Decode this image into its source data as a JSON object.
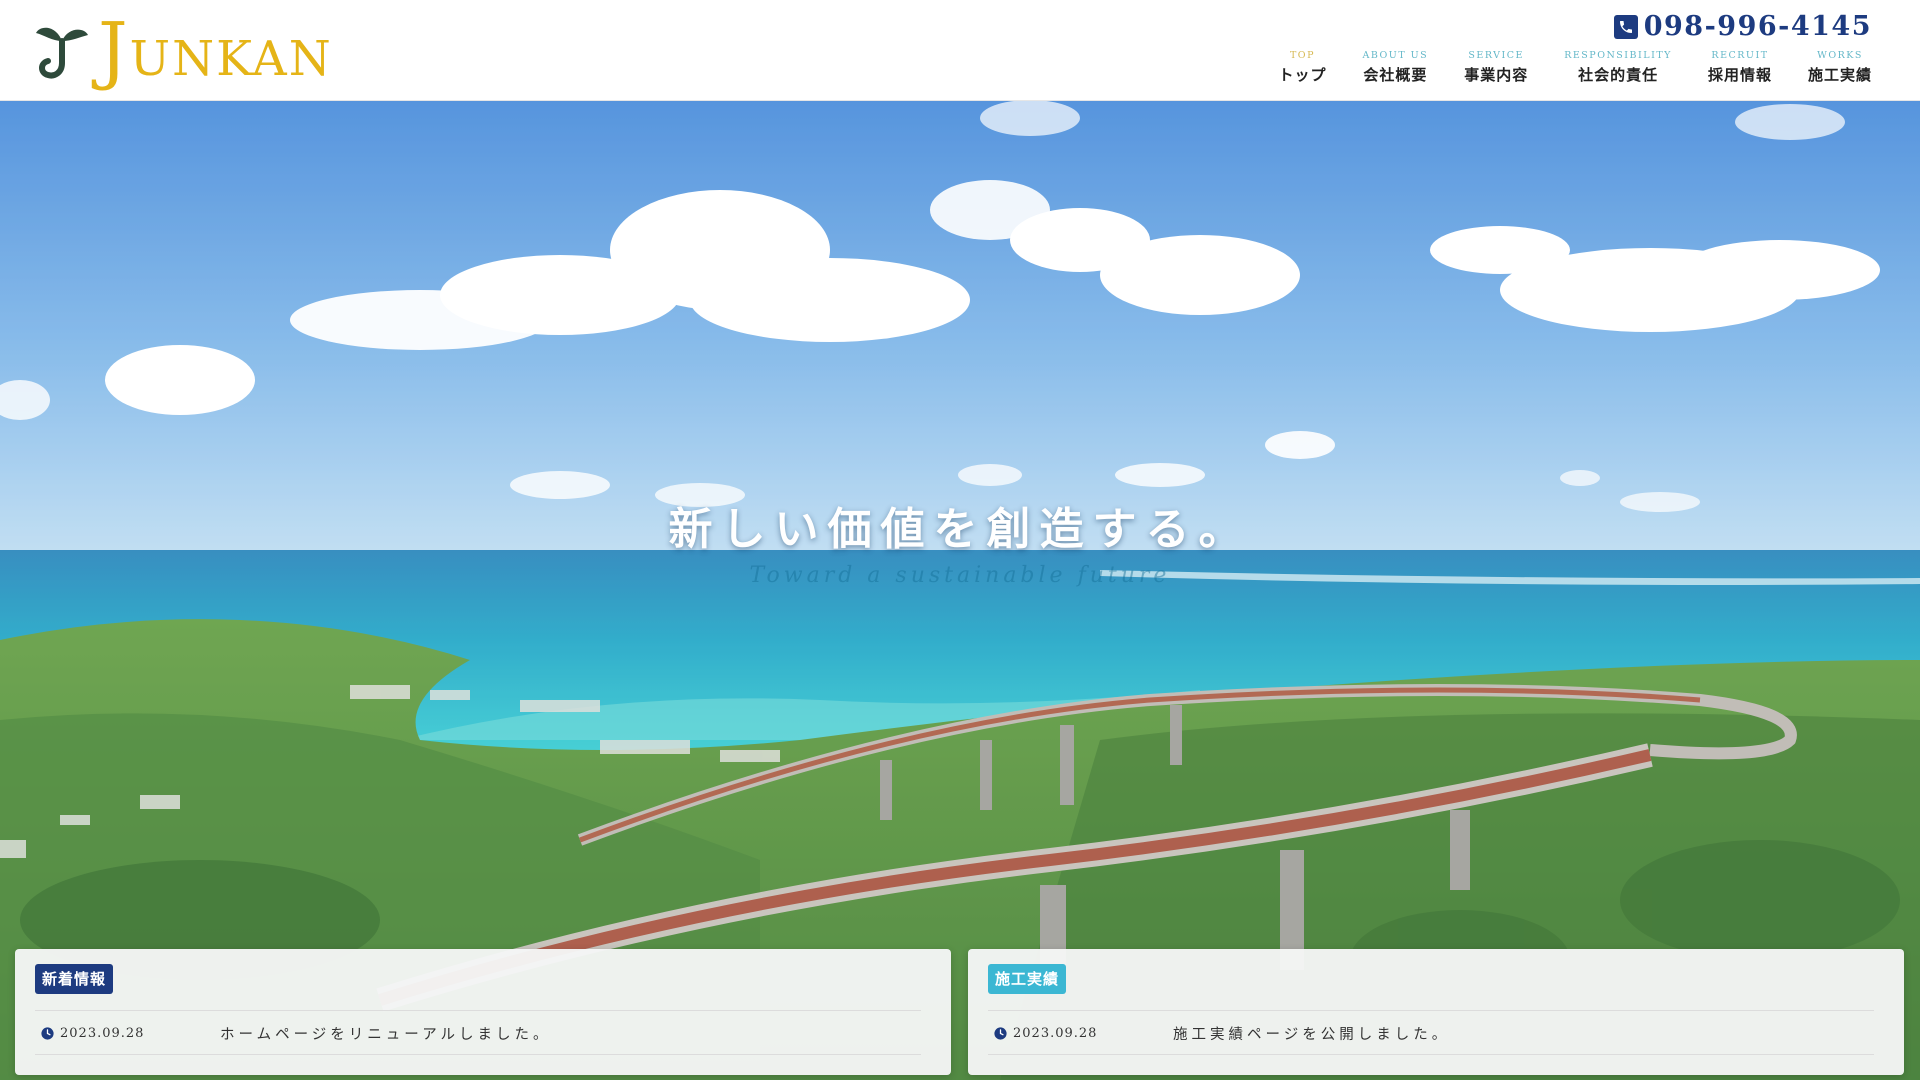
{
  "header": {
    "logo_initial": "J",
    "logo_rest": "UNKAN",
    "phone": "098-996-4145"
  },
  "nav": [
    {
      "en": "TOP",
      "ja": "トップ"
    },
    {
      "en": "ABOUT US",
      "ja": "会社概要"
    },
    {
      "en": "SERVICE",
      "ja": "事業内容"
    },
    {
      "en": "RESPONSIBILITY",
      "ja": "社会的責任"
    },
    {
      "en": "RECRUIT",
      "ja": "採用情報"
    },
    {
      "en": "WORKS",
      "ja": "施工実績"
    }
  ],
  "hero": {
    "title": "新しい価値を創造する。",
    "subtitle": "Toward a sustainable future"
  },
  "news": {
    "label": "新着情報",
    "items": [
      {
        "date": "2023.09.28",
        "text": "ホームページをリニューアルしました。"
      }
    ]
  },
  "works": {
    "label": "施工実績",
    "items": [
      {
        "date": "2023.09.28",
        "text": "施工実績ページを公開しました。"
      }
    ]
  },
  "colors": {
    "brand_gold": "#e5b417",
    "brand_navy": "#1d3b80",
    "accent_cyan": "#3bb7d3",
    "logo_green": "#2e4a3b"
  },
  "icons": {
    "phone": "phone-icon",
    "clock": "clock-icon",
    "logo": "sprout-icon"
  }
}
